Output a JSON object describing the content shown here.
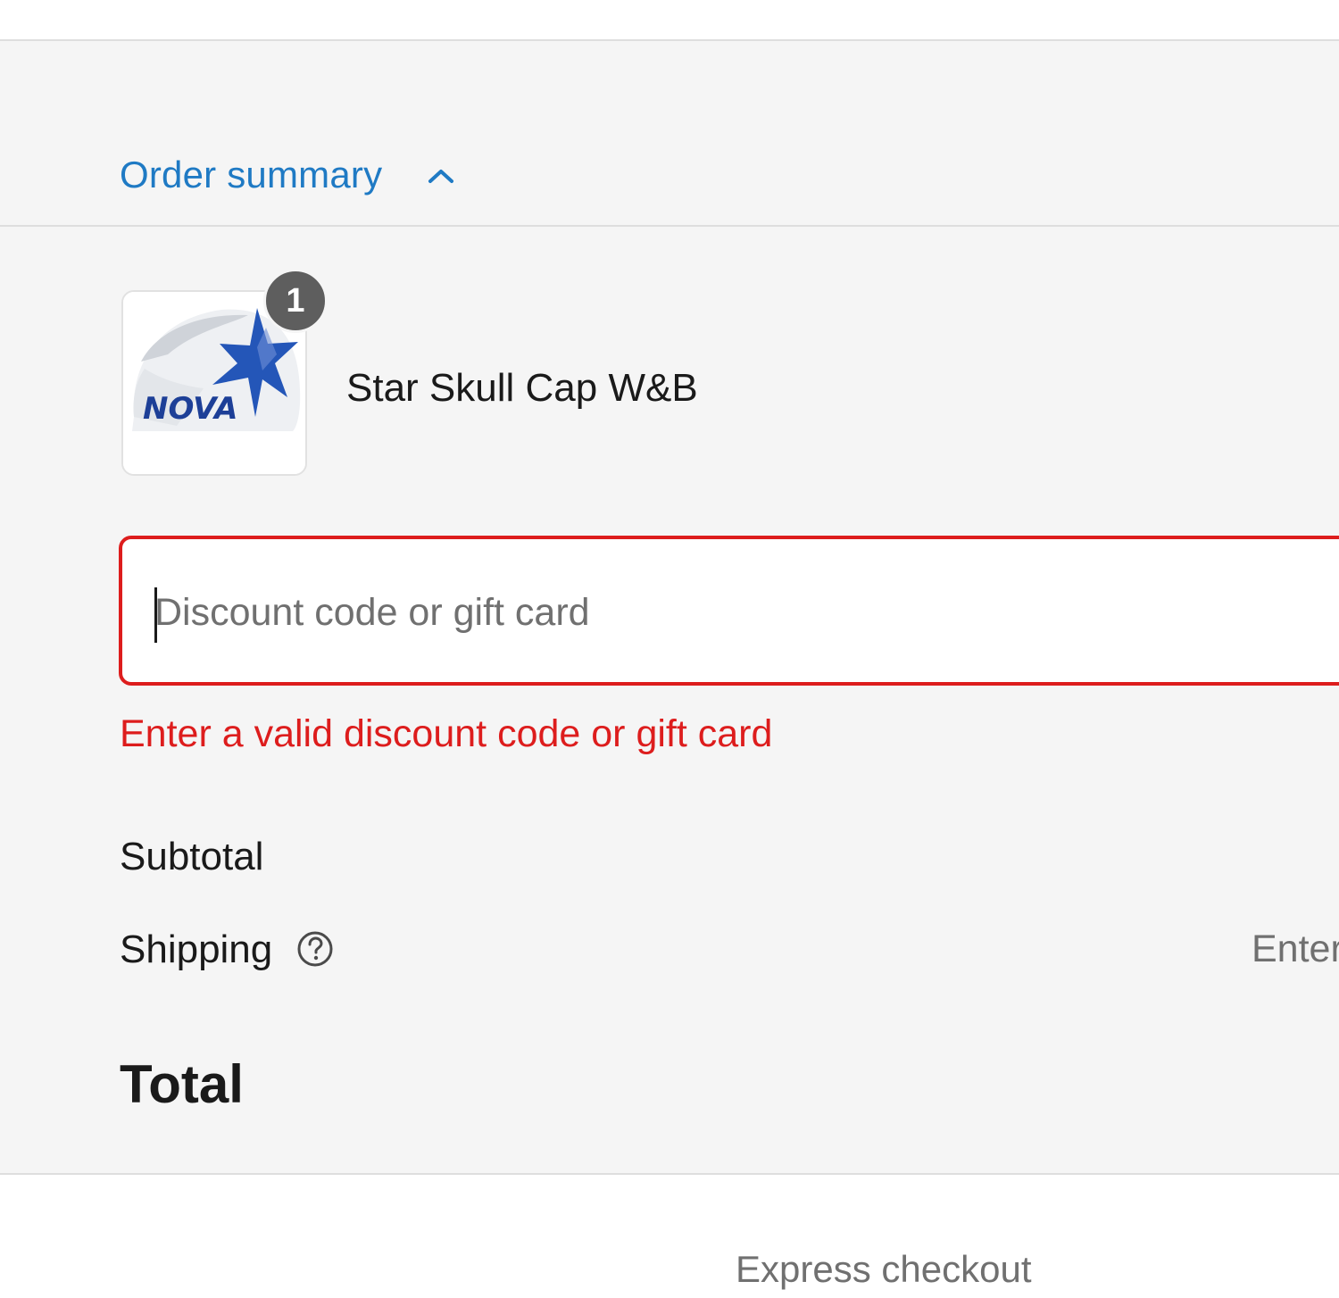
{
  "summary_toggle": {
    "label": "Order summary",
    "icon": "chevron-up-icon",
    "expanded": true
  },
  "line_items": [
    {
      "name": "Star Skull Cap W&B",
      "quantity": "1",
      "thumbnail_logo_text": "NOVA"
    }
  ],
  "discount": {
    "placeholder": "Discount code or gift card",
    "value": "",
    "error": "Enter a valid discount code or gift card"
  },
  "totals": {
    "subtotal_label": "Subtotal",
    "shipping_label": "Shipping",
    "shipping_help_icon": "question-circle-icon",
    "shipping_value": "Enter",
    "total_label": "Total"
  },
  "express": {
    "label": "Express checkout"
  },
  "colors": {
    "link": "#1f7ac4",
    "error": "#dd1d1d",
    "panel_bg": "#f5f5f5",
    "badge_bg": "#5e5e5e",
    "muted_text": "#707070"
  }
}
